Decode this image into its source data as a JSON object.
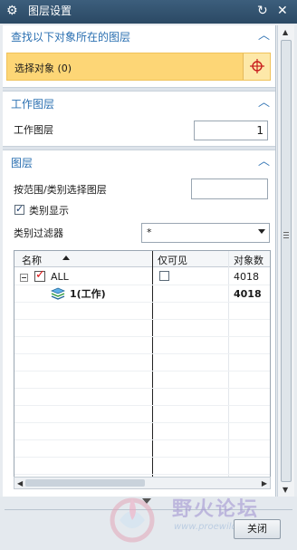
{
  "window": {
    "title": "图层设置",
    "icons": [
      "gear-icon",
      "reset-icon",
      "close-icon"
    ]
  },
  "find_section": {
    "title": "查找以下对象所在的图层",
    "select_label": "选择对象 (0)"
  },
  "work_section": {
    "title": "工作图层",
    "field_label": "工作图层",
    "field_value": "1"
  },
  "layer_section": {
    "title": "图层",
    "range_label": "按范围/类别选择图层",
    "range_value": "",
    "category_display_label": "类别显示",
    "category_display_checked": true,
    "filter_label": "类别过滤器",
    "filter_value": "*"
  },
  "grid": {
    "columns": [
      "名称",
      "仅可见",
      "对象数"
    ],
    "rows": [
      {
        "name": "ALL",
        "visible_only": false,
        "count": "4018"
      },
      {
        "name": "1(工作)",
        "visible_only": "",
        "count": "4018"
      }
    ]
  },
  "footer": {
    "close_label": "关闭"
  },
  "watermark": {
    "text": "野火论坛",
    "url": "www.proewildfire.cn"
  },
  "colors": {
    "title_bar": "#2b4964",
    "section_title": "#2a6fb1",
    "selection_row": "#fdd676"
  }
}
